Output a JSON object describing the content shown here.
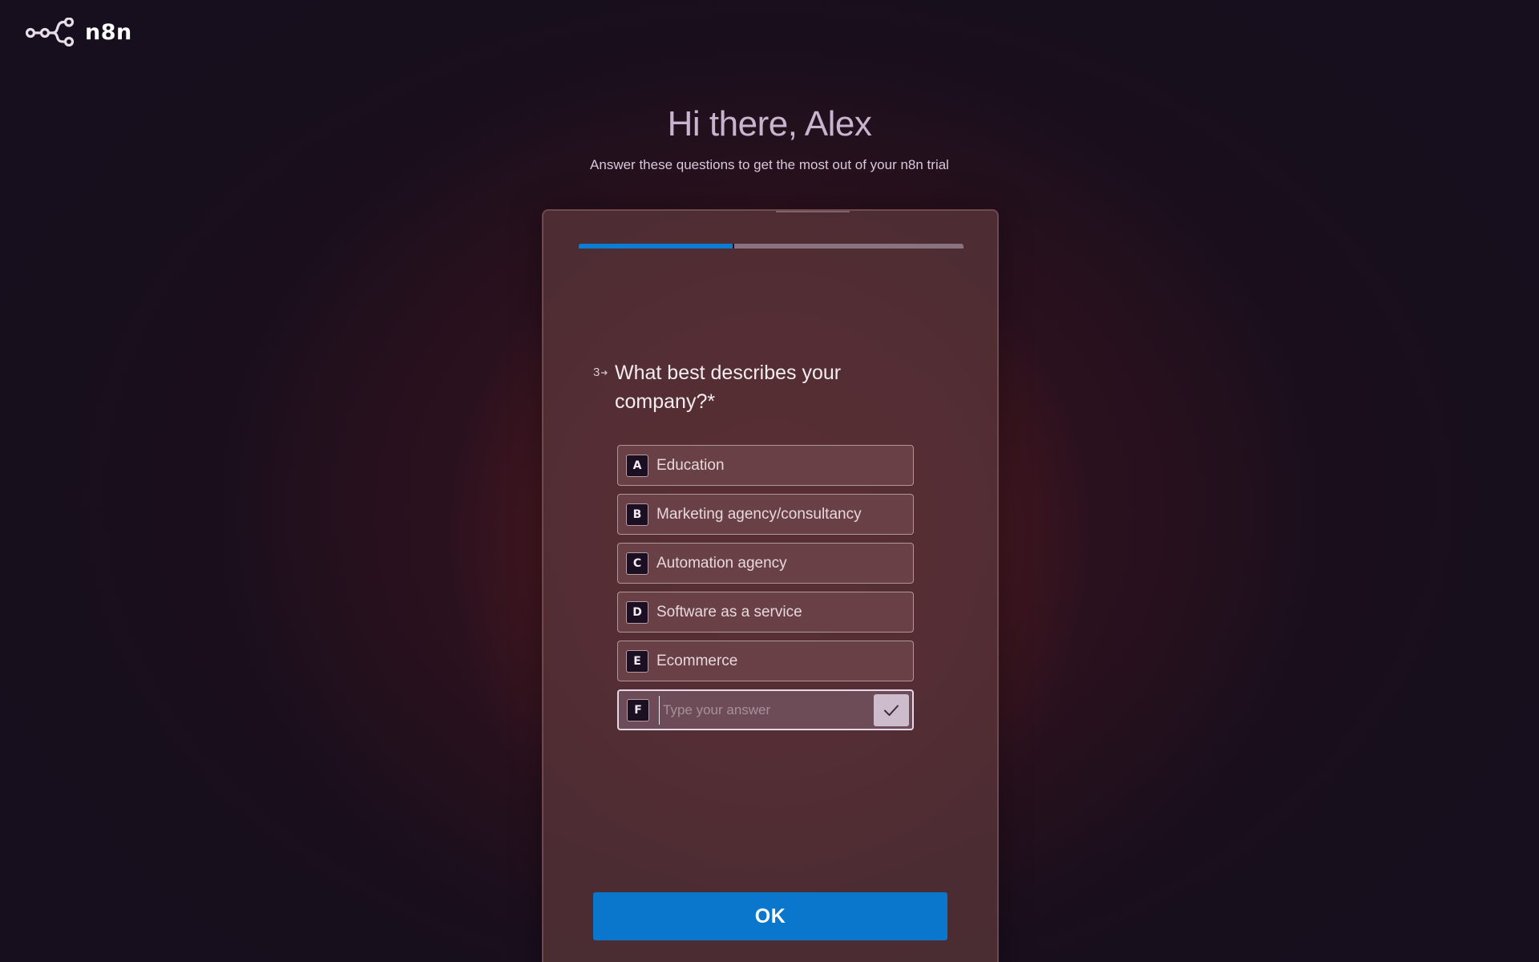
{
  "brand": {
    "name": "n8n",
    "logo_icon": "n8n-logo-icon"
  },
  "header": {
    "greeting": "Hi there, Alex",
    "subtitle": "Answer these questions to get the most out of your n8n trial"
  },
  "progress": {
    "fraction": 0.4,
    "fill_color": "#0d7dd3"
  },
  "question": {
    "number": "3",
    "arrow_icon": "arrow-right-icon",
    "text": "What best describes your company?*"
  },
  "options": [
    {
      "key": "A",
      "label": "Education"
    },
    {
      "key": "B",
      "label": "Marketing agency/consultancy"
    },
    {
      "key": "C",
      "label": "Automation agency"
    },
    {
      "key": "D",
      "label": "Software as a service"
    },
    {
      "key": "E",
      "label": "Ecommerce"
    }
  ],
  "other_option": {
    "key": "F",
    "value": "",
    "placeholder": "Type your answer",
    "confirm_icon": "check-icon"
  },
  "ok_button": {
    "label": "OK",
    "color": "#0b77cc"
  }
}
